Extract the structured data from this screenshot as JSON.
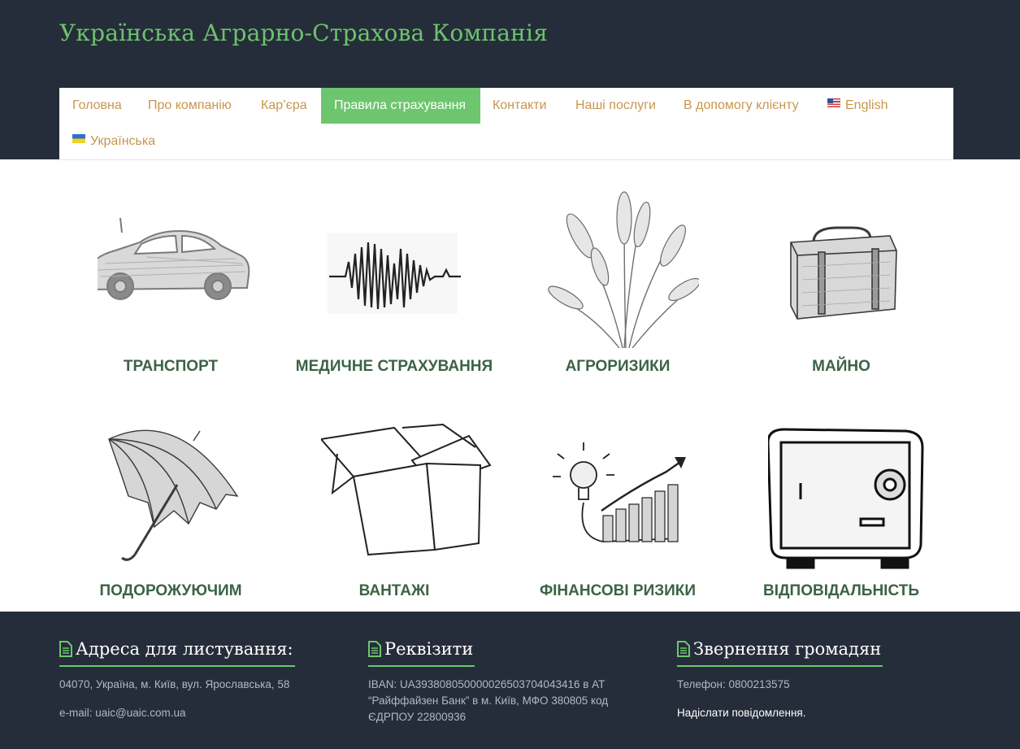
{
  "site": {
    "title": "Українська Аграрно-Страхова Компанія"
  },
  "nav": {
    "items": [
      {
        "label": "Головна"
      },
      {
        "label": "Про компанію"
      },
      {
        "label": "Кар’єра"
      },
      {
        "label": "Правила страхування",
        "active": true
      },
      {
        "label": "Контакти"
      },
      {
        "label": "Наші послуги"
      },
      {
        "label": "В допомогу клієнту"
      },
      {
        "label": "English",
        "icon": "us-flag-icon"
      },
      {
        "label": "Українська",
        "icon": "ua-flag-icon"
      }
    ]
  },
  "tiles": [
    {
      "label": "ТРАНСПОРТ",
      "icon": "car-sketch-icon"
    },
    {
      "label": "МЕДИЧНЕ СТРАХУВАННЯ",
      "icon": "heartbeat-sketch-icon"
    },
    {
      "label": "АГРОРИЗИКИ",
      "icon": "wheat-sketch-icon"
    },
    {
      "label": "МАЙНО",
      "icon": "suitcase-sketch-icon"
    },
    {
      "label": "ПОДОРОЖУЮЧИМ",
      "icon": "umbrella-sketch-icon"
    },
    {
      "label": "ВАНТАЖІ",
      "icon": "box-sketch-icon"
    },
    {
      "label": "ФІНАНСОВІ РИЗИКИ",
      "icon": "growth-chart-sketch-icon"
    },
    {
      "label": "ВІДПОВІДАЛЬНІСТЬ",
      "icon": "safe-sketch-icon"
    }
  ],
  "footer": {
    "address": {
      "heading": "Адреса для листування:",
      "line": "04070, Україна, м. Київ, вул. Ярославська, 58",
      "email": "e-mail: uaic@uaic.com.ua"
    },
    "requisites": {
      "heading": "Реквізити",
      "line1": "IBAN: UA393808050000026503704043416 в АТ",
      "line2": "“Райффайзен Банк” в м. Київ, МФО 380805 код",
      "line3": "ЄДРПОУ 22800936"
    },
    "appeals": {
      "heading": "Звернення громадян",
      "phone": "Телефон: 0800213575",
      "link": "Надіслати повідомлення."
    }
  },
  "colors": {
    "dark_bg": "#262d3a",
    "accent_green": "#6dc66e",
    "nav_text": "#c8964e",
    "tile_label": "#3c6345"
  }
}
